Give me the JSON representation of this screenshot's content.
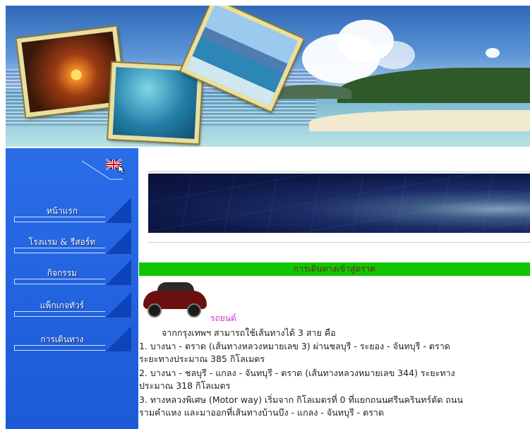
{
  "nav": {
    "items": [
      {
        "label": "หน้าแรก"
      },
      {
        "label": "โรงแรม & รีสอร์ท"
      },
      {
        "label": "กิจกรรม"
      },
      {
        "label": "แพ็กเกจทัวร์"
      },
      {
        "label": "การเดินทาง"
      }
    ],
    "lang_icon": "uk-flag-icon"
  },
  "main": {
    "section_title": "การเดินทางเข้าสู่ตราด",
    "car_label": "รถยนต์",
    "intro": "จากกรุงเทพฯ สามารถใช้เส้นทางได้ 3 สาย คือ",
    "routes": [
      "1. บางนา - ตราด (เส้นทางหลวงหมายเลข 3) ผ่านชลบุรี - ระยอง - จันทบุรี - ตราด",
      "ระยะทางประมาณ 385 กิโลเมตร",
      "2. บางนา - ชลบุรี - แกลง - จันทบุรี - ตราด (เส้นทางหลวงหมายเลข 344) ระยะทาง",
      "ประมาณ 318 กิโลเมตร",
      "3. ทางหลวงพิเศษ (Motor way) เริ่มจาก กิโลเมตรที่ 0 ที่แยกถนนศรีนครินทร์ตัด ถนน",
      "รามคำแหง และมาออกที่เส้นทางบ้านบึง - แกลง - จันทบุรี - ตราด"
    ]
  },
  "colors": {
    "sidebar": "#1f63e2",
    "section_bar": "#11c500",
    "car_label": "#cc33cc"
  }
}
